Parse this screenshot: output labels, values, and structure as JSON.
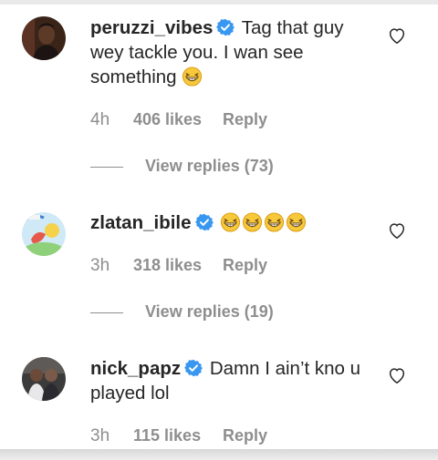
{
  "comments": [
    {
      "username": "peruzzi_vibes",
      "text": "Tag that guy wey tackle you. I wan see something",
      "emoji_count": 1,
      "time": "4h",
      "likes": "406 likes",
      "reply": "Reply",
      "view_replies": "View replies (73)"
    },
    {
      "username": "zlatan_ibile",
      "text": "",
      "emoji_count": 4,
      "time": "3h",
      "likes": "318 likes",
      "reply": "Reply",
      "view_replies": "View replies (19)"
    },
    {
      "username": "nick_papz",
      "text": "Damn I ain’t kno u played lol",
      "emoji_count": 0,
      "time": "3h",
      "likes": "115 likes",
      "reply": "Reply"
    }
  ],
  "icons": {
    "verified": "verified-badge-icon",
    "heart": "heart-outline-icon",
    "emoji": "grinning-squinting-face-emoji"
  },
  "colors": {
    "verified_blue": "#3897f0",
    "meta_gray": "#8e8e8e",
    "text": "#262626"
  }
}
